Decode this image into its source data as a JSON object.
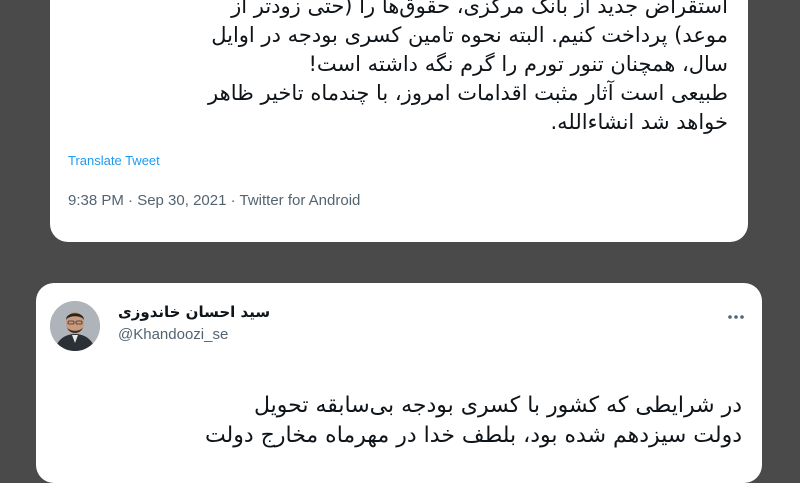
{
  "tweet1": {
    "lines": [
      "استقراض جدید از بانک مرکزی، حقوق‌ها را (حتی زودتر از",
      "موعد) پرداخت کنیم. البته نحوه تامین کسری بودجه در اوایل",
      "سال، همچنان تنور تورم را گرم نگه داشته است!",
      "طبیعی است آثار مثبت اقدامات امروز، با چندماه تاخیر ظاهر",
      "خواهد شد انشاءالله."
    ],
    "translate_label": "Translate Tweet",
    "timestamp": "9:38 PM · Sep 30, 2021 · Twitter for Android"
  },
  "tweet2": {
    "display_name": "سید احسان خاندوزی",
    "handle": "@Khandoozi_se",
    "more_icon": "ellipsis-icon",
    "lines": [
      "در شرایطی که کشور با کسری بودجه بی‌سابقه تحویل",
      "دولت سیزدهم شده بود، بلطف خدا در مهرماه مخارج دولت"
    ]
  }
}
